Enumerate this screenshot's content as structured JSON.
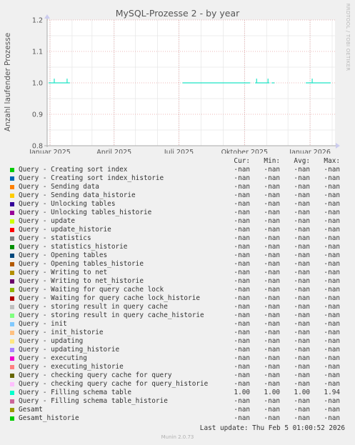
{
  "title": "MySQL-Prozesse 2 - by year",
  "side_label": "RRDTOOL / TOBI OETIKER",
  "footer": "Munin 2.0.73",
  "last_update": "Last update: Thu Feb  5 01:00:52 2026",
  "legend_headers": {
    "cur": "Cur:",
    "min": "Min:",
    "avg": "Avg:",
    "max": "Max:"
  },
  "chart_data": {
    "type": "line",
    "title": "MySQL-Prozesse 2 - by year",
    "ylabel": "Anzahl laufender Prozesse",
    "ylim": [
      0.8,
      1.2
    ],
    "yticks": [
      "0.8",
      "0.9",
      "1.0",
      "1.1",
      "1.2"
    ],
    "x_range": [
      "2024-12-28",
      "2026-02-05"
    ],
    "xticks": [
      {
        "label": "Januar 2025",
        "date": "2025-01-01"
      },
      {
        "label": "April 2025",
        "date": "2025-04-01"
      },
      {
        "label": "Juli 2025",
        "date": "2025-07-01"
      },
      {
        "label": "Oktober 2025",
        "date": "2025-10-01"
      },
      {
        "label": "Januar 2026",
        "date": "2026-01-01"
      }
    ],
    "grid": true,
    "series": [
      {
        "name": "Query - Filling schema table",
        "color": "#1ee3c5",
        "values": 1.0,
        "segments": [
          [
            "2024-12-30",
            "2025-01-29"
          ],
          [
            "2025-07-06",
            "2025-10-09"
          ],
          [
            "2025-10-16",
            "2025-11-05"
          ],
          [
            "2025-11-08",
            "2025-11-12"
          ],
          [
            "2025-12-26",
            "2026-01-30"
          ]
        ],
        "spikes": [
          {
            "date": "2025-01-07",
            "value": 1.01
          },
          {
            "date": "2025-01-25",
            "value": 1.01
          },
          {
            "date": "2025-10-18",
            "value": 1.01
          },
          {
            "date": "2025-11-03",
            "value": 1.01
          },
          {
            "date": "2026-01-04",
            "value": 1.01
          }
        ]
      }
    ]
  },
  "legend": [
    {
      "name": "Query - Creating sort index",
      "color": "#00cc00",
      "cur": "-nan",
      "min": "-nan",
      "avg": "-nan",
      "max": "-nan"
    },
    {
      "name": "Query - Creating sort index_historie",
      "color": "#0066b3",
      "cur": "-nan",
      "min": "-nan",
      "avg": "-nan",
      "max": "-nan"
    },
    {
      "name": "Query - Sending data",
      "color": "#ff8000",
      "cur": "-nan",
      "min": "-nan",
      "avg": "-nan",
      "max": "-nan"
    },
    {
      "name": "Query - Sending data_historie",
      "color": "#ffcc00",
      "cur": "-nan",
      "min": "-nan",
      "avg": "-nan",
      "max": "-nan"
    },
    {
      "name": "Query - Unlocking tables",
      "color": "#330099",
      "cur": "-nan",
      "min": "-nan",
      "avg": "-nan",
      "max": "-nan"
    },
    {
      "name": "Query - Unlocking tables_historie",
      "color": "#990099",
      "cur": "-nan",
      "min": "-nan",
      "avg": "-nan",
      "max": "-nan"
    },
    {
      "name": "Query - update",
      "color": "#ccff00",
      "cur": "-nan",
      "min": "-nan",
      "avg": "-nan",
      "max": "-nan"
    },
    {
      "name": "Query - update_historie",
      "color": "#ff0000",
      "cur": "-nan",
      "min": "-nan",
      "avg": "-nan",
      "max": "-nan"
    },
    {
      "name": "Query - statistics",
      "color": "#808080",
      "cur": "-nan",
      "min": "-nan",
      "avg": "-nan",
      "max": "-nan"
    },
    {
      "name": "Query - statistics_historie",
      "color": "#008f00",
      "cur": "-nan",
      "min": "-nan",
      "avg": "-nan",
      "max": "-nan"
    },
    {
      "name": "Query - Opening tables",
      "color": "#00487d",
      "cur": "-nan",
      "min": "-nan",
      "avg": "-nan",
      "max": "-nan"
    },
    {
      "name": "Query - Opening tables_historie",
      "color": "#b35a00",
      "cur": "-nan",
      "min": "-nan",
      "avg": "-nan",
      "max": "-nan"
    },
    {
      "name": "Query - Writing to net",
      "color": "#b38f00",
      "cur": "-nan",
      "min": "-nan",
      "avg": "-nan",
      "max": "-nan"
    },
    {
      "name": "Query - Writing to net_historie",
      "color": "#6b006b",
      "cur": "-nan",
      "min": "-nan",
      "avg": "-nan",
      "max": "-nan"
    },
    {
      "name": "Query - Waiting for query cache lock",
      "color": "#8fb300",
      "cur": "-nan",
      "min": "-nan",
      "avg": "-nan",
      "max": "-nan"
    },
    {
      "name": "Query - Waiting for query cache lock_historie",
      "color": "#b30000",
      "cur": "-nan",
      "min": "-nan",
      "avg": "-nan",
      "max": "-nan"
    },
    {
      "name": "Query - storing result in query cache",
      "color": "#bebebe",
      "cur": "-nan",
      "min": "-nan",
      "avg": "-nan",
      "max": "-nan"
    },
    {
      "name": "Query - storing result in query cache_historie",
      "color": "#80ff80",
      "cur": "-nan",
      "min": "-nan",
      "avg": "-nan",
      "max": "-nan"
    },
    {
      "name": "Query - init",
      "color": "#80c9ff",
      "cur": "-nan",
      "min": "-nan",
      "avg": "-nan",
      "max": "-nan"
    },
    {
      "name": "Query - init_historie",
      "color": "#ffc080",
      "cur": "-nan",
      "min": "-nan",
      "avg": "-nan",
      "max": "-nan"
    },
    {
      "name": "Query - updating",
      "color": "#ffe680",
      "cur": "-nan",
      "min": "-nan",
      "avg": "-nan",
      "max": "-nan"
    },
    {
      "name": "Query - updating_historie",
      "color": "#aa80ff",
      "cur": "-nan",
      "min": "-nan",
      "avg": "-nan",
      "max": "-nan"
    },
    {
      "name": "Query - executing",
      "color": "#ee00cc",
      "cur": "-nan",
      "min": "-nan",
      "avg": "-nan",
      "max": "-nan"
    },
    {
      "name": "Query - executing_historie",
      "color": "#ff8080",
      "cur": "-nan",
      "min": "-nan",
      "avg": "-nan",
      "max": "-nan"
    },
    {
      "name": "Query - checking query cache for query",
      "color": "#666600",
      "cur": "-nan",
      "min": "-nan",
      "avg": "-nan",
      "max": "-nan"
    },
    {
      "name": "Query - checking query cache for query_historie",
      "color": "#ffbfff",
      "cur": "-nan",
      "min": "-nan",
      "avg": "-nan",
      "max": "-nan"
    },
    {
      "name": "Query - Filling schema table",
      "color": "#00ffcc",
      "cur": "1.00",
      "min": "1.00",
      "avg": "1.00",
      "max": "1.94"
    },
    {
      "name": "Query - Filling schema table_historie",
      "color": "#cc6699",
      "cur": "-nan",
      "min": "-nan",
      "avg": "-nan",
      "max": "-nan"
    },
    {
      "name": "Gesamt",
      "color": "#999900",
      "cur": "-nan",
      "min": "-nan",
      "avg": "-nan",
      "max": "-nan"
    },
    {
      "name": "Gesamt_historie",
      "color": "#00cc00",
      "cur": "-nan",
      "min": "-nan",
      "avg": "-nan",
      "max": "-nan"
    }
  ]
}
